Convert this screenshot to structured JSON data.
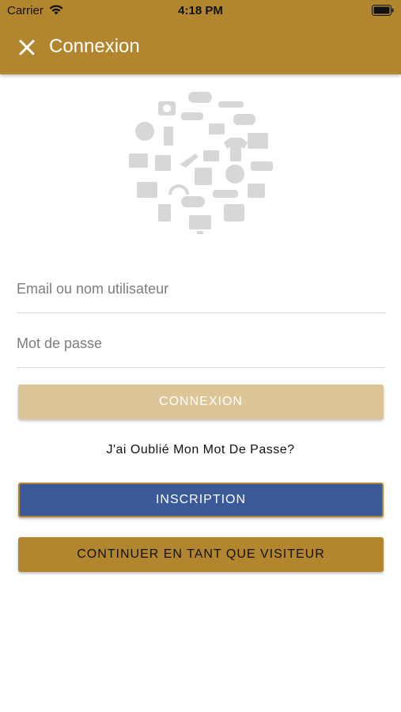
{
  "status_bar": {
    "carrier": "Carrier",
    "time": "4:18 PM"
  },
  "header": {
    "title": "Connexion",
    "close_icon": "close-icon"
  },
  "logo": {
    "icon": "shopping-icons-circle-icon"
  },
  "form": {
    "email_placeholder": "Email ou nom utilisateur",
    "password_placeholder": "Mot de passe"
  },
  "buttons": {
    "login": "CONNEXION",
    "forgot": "J'ai Oublié Mon Mot De Passe?",
    "register": "INSCRIPTION",
    "guest": "CONTINUER EN TANT QUE VISITEUR"
  },
  "colors": {
    "primary": "#b2862e",
    "login_disabled": "#dcc596",
    "register": "#3b5a9a"
  }
}
